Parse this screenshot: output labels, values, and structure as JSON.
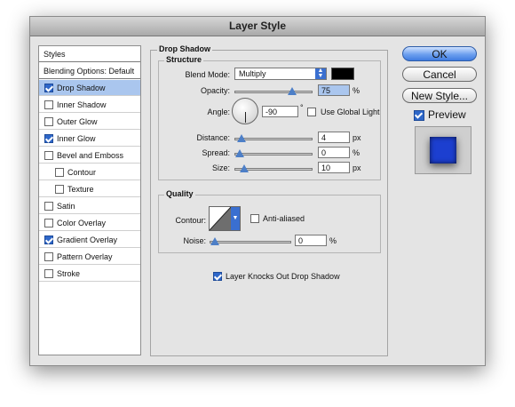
{
  "window": {
    "title": "Layer Style"
  },
  "styles_list": {
    "header": "Styles",
    "blending": "Blending Options: Default",
    "items": [
      {
        "label": "Drop Shadow",
        "checked": true,
        "selected": true
      },
      {
        "label": "Inner Shadow",
        "checked": false
      },
      {
        "label": "Outer Glow",
        "checked": false
      },
      {
        "label": "Inner Glow",
        "checked": true
      },
      {
        "label": "Bevel and Emboss",
        "checked": false
      },
      {
        "label": "Contour",
        "checked": false,
        "indent": true
      },
      {
        "label": "Texture",
        "checked": false,
        "indent": true
      },
      {
        "label": "Satin",
        "checked": false
      },
      {
        "label": "Color Overlay",
        "checked": false
      },
      {
        "label": "Gradient Overlay",
        "checked": true
      },
      {
        "label": "Pattern Overlay",
        "checked": false
      },
      {
        "label": "Stroke",
        "checked": false
      }
    ]
  },
  "drop_shadow": {
    "title": "Drop Shadow",
    "structure": {
      "title": "Structure",
      "blend_mode_label": "Blend Mode:",
      "blend_mode_value": "Multiply",
      "shadow_color": "#000000",
      "opacity_label": "Opacity:",
      "opacity_value": "75",
      "opacity_unit": "%",
      "opacity_level": 0.75,
      "angle_label": "Angle:",
      "angle_value": "-90",
      "angle_unit": "°",
      "use_global_light_label": "Use Global Light",
      "use_global_light": false,
      "distance_label": "Distance:",
      "distance_value": "4",
      "distance_unit": "px",
      "distance_level": 0.03,
      "spread_label": "Spread:",
      "spread_value": "0",
      "spread_unit": "%",
      "spread_level": 0.0,
      "size_label": "Size:",
      "size_value": "10",
      "size_unit": "px",
      "size_level": 0.06
    },
    "quality": {
      "title": "Quality",
      "contour_label": "Contour:",
      "anti_aliased_label": "Anti-aliased",
      "anti_aliased": false,
      "noise_label": "Noise:",
      "noise_value": "0",
      "noise_unit": "%",
      "noise_level": 0.0
    },
    "knockout_label": "Layer Knocks Out Drop Shadow",
    "knockout": true
  },
  "buttons": {
    "ok": "OK",
    "cancel": "Cancel",
    "new_style": "New Style..."
  },
  "preview": {
    "label": "Preview",
    "checked": true,
    "swatch_color": "#1c3fd0"
  }
}
